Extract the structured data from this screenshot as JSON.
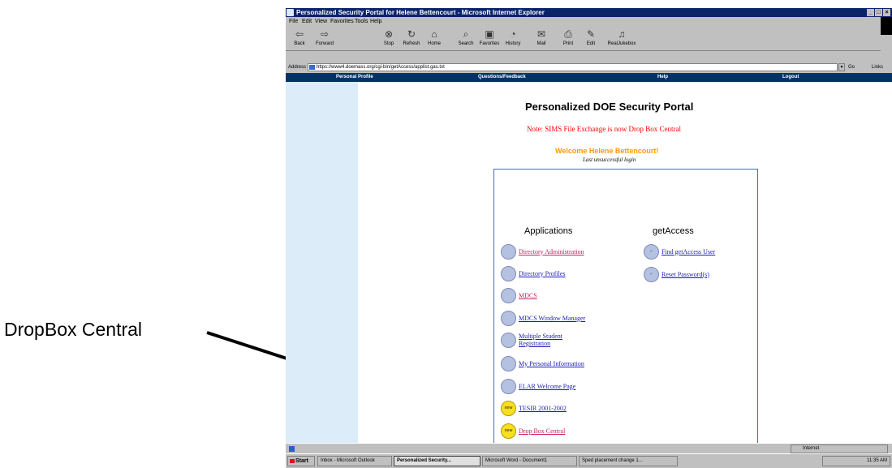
{
  "callout": {
    "label": "DropBox Central"
  },
  "browser": {
    "title": "Personalized Security Portal for Helene Bettencourt - Microsoft Internet Explorer",
    "window_buttons": [
      "_",
      "□",
      "×"
    ],
    "menu": [
      "File",
      "Edit",
      "View",
      "Favorites",
      "Tools",
      "Help"
    ],
    "toolbar": [
      {
        "label": "Back",
        "icon": "back-arrow-icon",
        "glyph": "⇦"
      },
      {
        "label": "Forward",
        "icon": "forward-arrow-icon",
        "glyph": "⇨"
      },
      {
        "label": "Stop",
        "icon": "stop-icon",
        "glyph": "⊗"
      },
      {
        "label": "Refresh",
        "icon": "refresh-icon",
        "glyph": "↻"
      },
      {
        "label": "Home",
        "icon": "home-icon",
        "glyph": "⌂"
      },
      {
        "label": "Search",
        "icon": "search-icon",
        "glyph": "⌕"
      },
      {
        "label": "Favorites",
        "icon": "favorites-icon",
        "glyph": "▣"
      },
      {
        "label": "History",
        "icon": "history-icon",
        "glyph": "◔"
      },
      {
        "label": "Mail",
        "icon": "mail-icon",
        "glyph": "✉"
      },
      {
        "label": "Print",
        "icon": "print-icon",
        "glyph": "⎙"
      },
      {
        "label": "Edit",
        "icon": "edit-icon",
        "glyph": "✎"
      },
      {
        "label": "RealJukebox",
        "icon": "realjukebox-icon",
        "glyph": "♫"
      }
    ],
    "address": {
      "label": "Address",
      "url": "https://www4.doemass.org/cgi-bin/getAccess/applist.gas.txt",
      "go": "Go",
      "links": "Links"
    }
  },
  "nav": [
    "Personal Profile",
    "Questions/Feedback",
    "Help",
    "Logout"
  ],
  "page": {
    "title": "Personalized DOE Security Portal",
    "note": "Note: SIMS File Exchange is now Drop Box Central",
    "welcome": "Welcome Helene Bettencourt!",
    "last_login": "Last unsuccessful login"
  },
  "applications": {
    "heading": "Applications",
    "items": [
      {
        "label": "Directory Administration",
        "icon": "application-icon"
      },
      {
        "label": "Directory Profiles",
        "icon": "application-icon"
      },
      {
        "label": "MDCS",
        "icon": "application-icon"
      },
      {
        "label": "MDCS Window Manager",
        "icon": "application-icon"
      },
      {
        "label": "Multiple Student Registration",
        "icon": "application-icon"
      },
      {
        "label": "My Personal Information",
        "icon": "application-icon"
      },
      {
        "label": "ELAR Welcome Page",
        "icon": "application-icon"
      },
      {
        "label": "TESIR 2001-2002",
        "icon": "new-badge-icon",
        "badge": "new"
      },
      {
        "label": "Drop Box Central",
        "icon": "new-badge-icon",
        "badge": "new"
      }
    ]
  },
  "getaccess": {
    "heading": "getAccess",
    "items": [
      {
        "label": "Find getAccess User",
        "icon": "getaccess-icon"
      },
      {
        "label": "Reset Password(s)",
        "icon": "getaccess-icon"
      }
    ]
  },
  "statusbar": {
    "zone": "Internet"
  },
  "taskbar": {
    "start": "Start",
    "tasks": [
      "Inbox - Microsoft Outlook",
      "Personalized Security...",
      "Microsoft Word - Document1",
      "Sped placement change 1..."
    ],
    "clock": "11:35 AM"
  },
  "colors": {
    "titlebar": "#0a246a",
    "navbar": "#003466",
    "note": "#ff0000",
    "welcome": "#ff9900",
    "link": "#1a1ab8",
    "arrow": "#000000"
  }
}
